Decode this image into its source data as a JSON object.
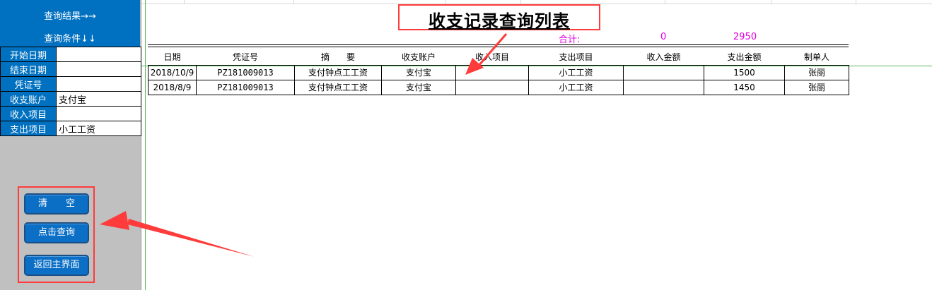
{
  "sidebar": {
    "header_results": "查询结果→→",
    "header_conditions": "查询条件↓↓",
    "conditions": [
      {
        "label": "开始日期",
        "value": ""
      },
      {
        "label": "结束日期",
        "value": ""
      },
      {
        "label": "凭证号",
        "value": ""
      },
      {
        "label": "收支账户",
        "value": "支付宝"
      },
      {
        "label": "收入项目",
        "value": ""
      },
      {
        "label": "支出项目",
        "value": "小工工资"
      }
    ],
    "buttons": {
      "clear": "清　　空",
      "query": "点击查询",
      "back": "返回主界面"
    }
  },
  "report": {
    "title": "收支记录查询列表",
    "total_label": "合计:",
    "total_income": "0",
    "total_expense": "2950",
    "columns": [
      "日期",
      "凭证号",
      "摘　　要",
      "收支账户",
      "收入项目",
      "支出项目",
      "收入金额",
      "支出金额",
      "制单人"
    ],
    "rows": [
      [
        "2018/10/9",
        "PZ181009013",
        "支付钟点工工资",
        "支付宝",
        "",
        "小工工资",
        "",
        "1500",
        "张丽"
      ],
      [
        "2018/8/9",
        "PZ181009013",
        "支付钟点工工资",
        "支付宝",
        "",
        "小工工资",
        "",
        "1450",
        "张丽"
      ]
    ]
  },
  "colors": {
    "header_blue": "#0070c0",
    "panel_gray": "#c0c0c0",
    "annotation_red": "#ff3b3b",
    "total_magenta": "#e000e0"
  }
}
